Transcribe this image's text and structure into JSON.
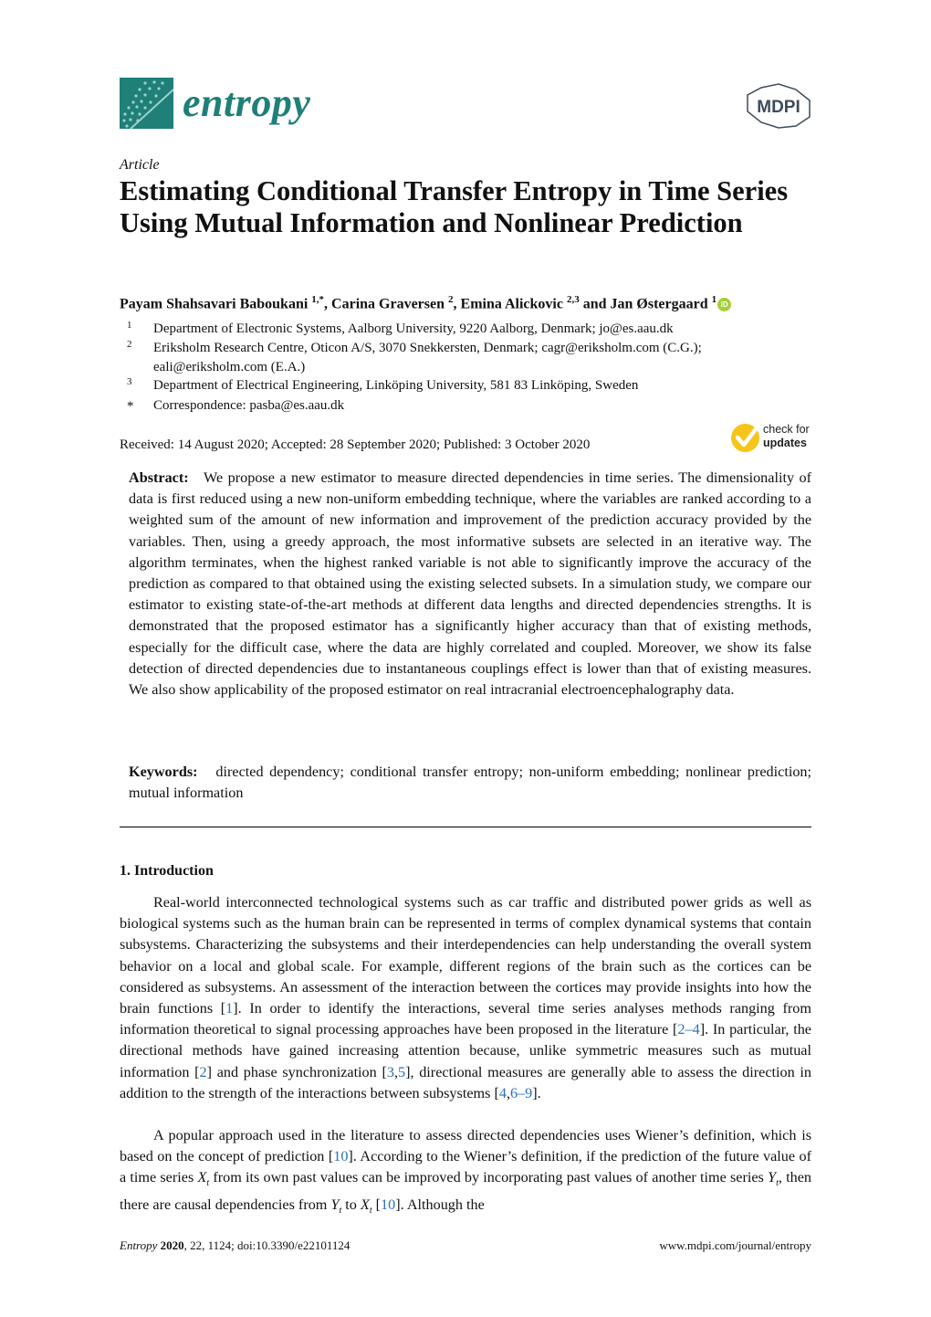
{
  "header": {
    "journal_name": "entropy",
    "publisher_logo": "MDPI",
    "brand_color": "#1f7f79",
    "publisher_color": "#3d4b5c"
  },
  "article": {
    "type": "Article",
    "title": "Estimating Conditional Transfer Entropy in Time Series Using Mutual Information and Nonlinear Prediction",
    "authors": [
      {
        "name": "Payam Shahsavari Baboukani",
        "sup": "1,*"
      },
      {
        "name": "Carina Graversen",
        "sup": "2"
      },
      {
        "name": "Emina Alickovic",
        "sup": "2,3"
      },
      {
        "name": "Jan Østergaard",
        "sup": "1"
      }
    ],
    "author_separators": [
      ", ",
      ", ",
      " and "
    ],
    "orcid_icon": "iD",
    "affiliations": [
      {
        "num": "1",
        "lines": [
          "Department of Electronic Systems, Aalborg University, 9220 Aalborg, Denmark; jo@es.aau.dk"
        ]
      },
      {
        "num": "2",
        "lines": [
          "Eriksholm Research Centre, Oticon A/S, 3070 Snekkersten, Denmark; cagr@eriksholm.com (C.G.);",
          "eali@eriksholm.com (E.A.)"
        ]
      },
      {
        "num": "3",
        "lines": [
          "Department of Electrical Engineering, Linköping University, 581 83 Linköping, Sweden"
        ]
      },
      {
        "num": "*",
        "lines": [
          "Correspondence: pasba@es.aau.dk"
        ]
      }
    ],
    "dates": "Received: 14 August 2020; Accepted: 28 September 2020; Published: 3 October 2020",
    "check_updates": {
      "line1": "check for",
      "line2": "updates"
    },
    "abstract": {
      "label": "Abstract:",
      "text": "We propose a new estimator to measure directed dependencies in time series. The dimensionality of data is first reduced using a new non-uniform embedding technique, where the variables are ranked according to a weighted sum of the amount of new information and improvement of the prediction accuracy provided by the variables. Then, using a greedy approach, the most informative subsets are selected in an iterative way. The algorithm terminates, when the highest ranked variable is not able to significantly improve the accuracy of the prediction as compared to that obtained using the existing selected subsets. In a simulation study, we compare our estimator to existing state-of-the-art methods at different data lengths and directed dependencies strengths. It is demonstrated that the proposed estimator has a significantly higher accuracy than that of existing methods, especially for the difficult case, where the data are highly correlated and coupled. Moreover, we show its false detection of directed dependencies due to instantaneous couplings effect is lower than that of existing measures. We also show applicability of the proposed estimator on real intracranial electroencephalography data."
    },
    "keywords": {
      "label": "Keywords:",
      "text": "directed dependency; conditional transfer entropy; non-uniform embedding; nonlinear prediction; mutual information"
    }
  },
  "section": {
    "heading": "1. Introduction",
    "p1": {
      "t1": "Real-world interconnected technological systems such as car traffic and distributed power grids as well as biological systems such as the human brain can be represented in terms of complex dynamical systems that contain subsystems. Characterizing the subsystems and their interdependencies can help understanding the overall system behavior on a local and global scale. For example, different regions of the brain such as the cortices can be considered as subsystems. An assessment of the interaction between the cortices may provide insights into how the brain functions [",
      "r1": "1",
      "t2": "]. In order to identify the interactions, several time series analyses methods ranging from information theoretical to signal processing approaches have been proposed in the literature [",
      "r2": "2–4",
      "t3": "]. In particular, the directional methods have gained increasing attention because, unlike symmetric measures such as mutual information [",
      "r3": "2",
      "t4": "] and phase synchronization [",
      "r4a": "3",
      "t4b": ",",
      "r4b": "5",
      "t5": "], directional measures are generally able to assess the direction in addition to the strength of the interactions between subsystems [",
      "r5a": "4",
      "t5b": ",",
      "r5b": "6–9",
      "t6": "]."
    },
    "p2": {
      "t1": "A popular approach used in the literature to assess directed dependencies uses Wiener’s definition, which is based on the concept of prediction [",
      "r1": "10",
      "t2": "]. According to the Wiener’s definition, if the prediction of the future value of a time series ",
      "x": "X",
      "sub": "t",
      "t3": " from its own past values can be improved by incorporating past values of another time series ",
      "y": "Y",
      "t4": ", then there are causal dependencies from ",
      "t5": " to ",
      "t6": " [",
      "r2": "10",
      "t7": "]. Although the"
    }
  },
  "footer": {
    "journal": "Entropy",
    "year": "2020",
    "rest": ", 22, 1124; doi:10.3390/e22101124",
    "url": "www.mdpi.com/journal/entropy"
  }
}
